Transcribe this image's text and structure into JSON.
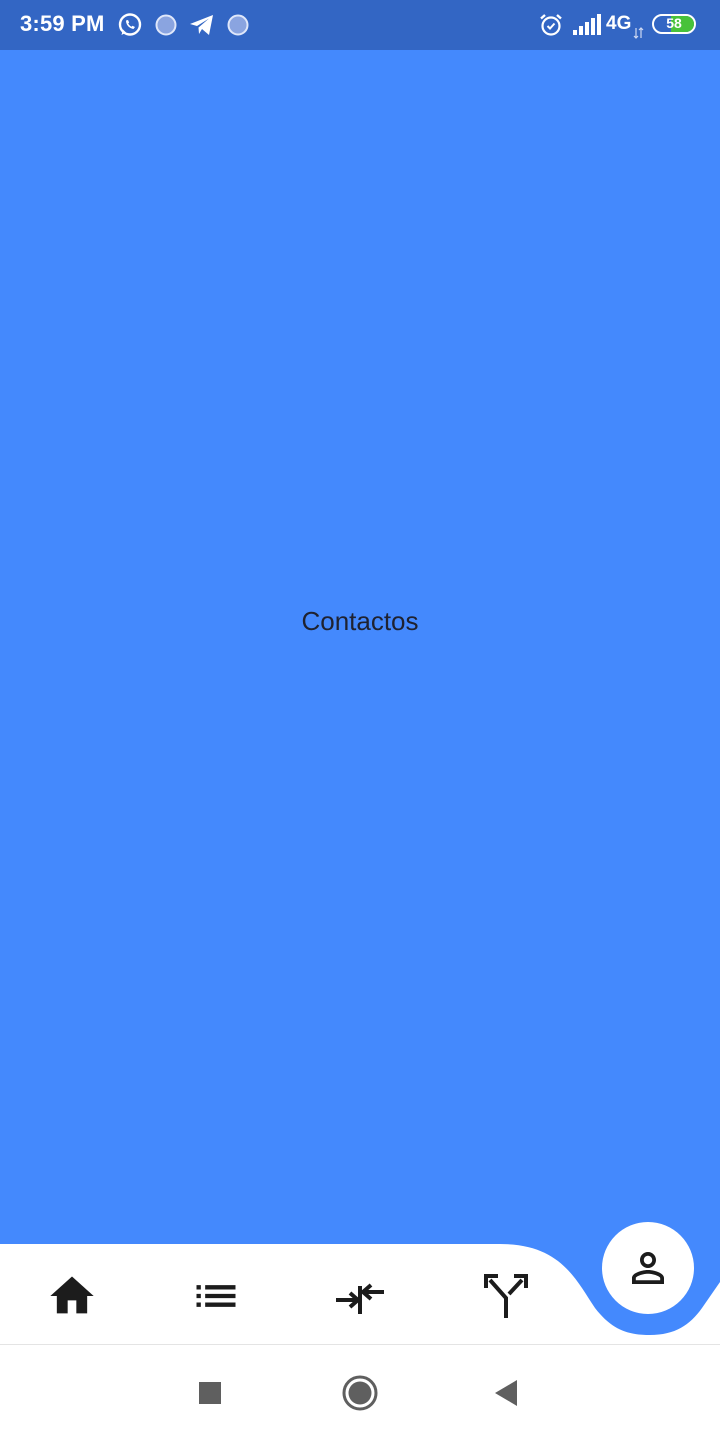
{
  "status_bar": {
    "time": "3:59 PM",
    "network": "4G",
    "battery": "58",
    "battery_level": 0.58,
    "background_color": "#3366c4",
    "icons": [
      "whatsapp-icon",
      "notification-dot-icon",
      "telegram-icon",
      "notification-dot-icon",
      "alarm-icon",
      "signal-icon",
      "battery-icon"
    ]
  },
  "main": {
    "title": "Contactos",
    "background_color": "#4489fd"
  },
  "bottom_nav": {
    "items": [
      {
        "icon": "home-icon"
      },
      {
        "icon": "list-icon"
      },
      {
        "icon": "compress-arrows-icon"
      },
      {
        "icon": "merge-arrows-icon"
      }
    ],
    "active_item": {
      "icon": "person-icon"
    },
    "accent_color": "#4489fd"
  },
  "system_nav": {
    "buttons": [
      "recents-button",
      "home-button",
      "back-button"
    ]
  }
}
